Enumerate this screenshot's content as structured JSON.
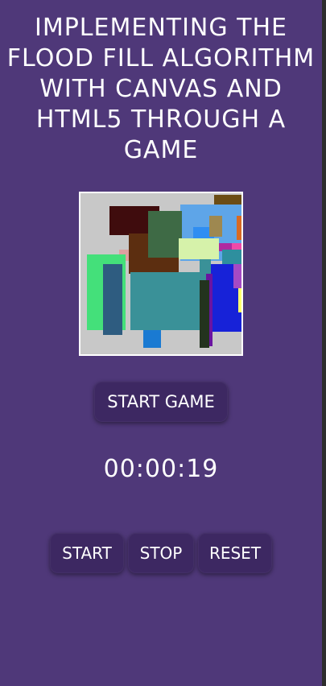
{
  "page": {
    "title": "IMPLEMENTING THE FLOOD FILL ALGORITHM WITH CANVAS AND HTML5 THROUGH A GAME"
  },
  "game": {
    "start_game_label": "START GAME"
  },
  "timer": {
    "value": "00:00:19"
  },
  "controls": {
    "start_label": "START",
    "stop_label": "STOP",
    "reset_label": "RESET"
  },
  "colors": {
    "background": "#4f3879",
    "button": "#3d2862",
    "canvas_base": "#c8c8c8"
  }
}
